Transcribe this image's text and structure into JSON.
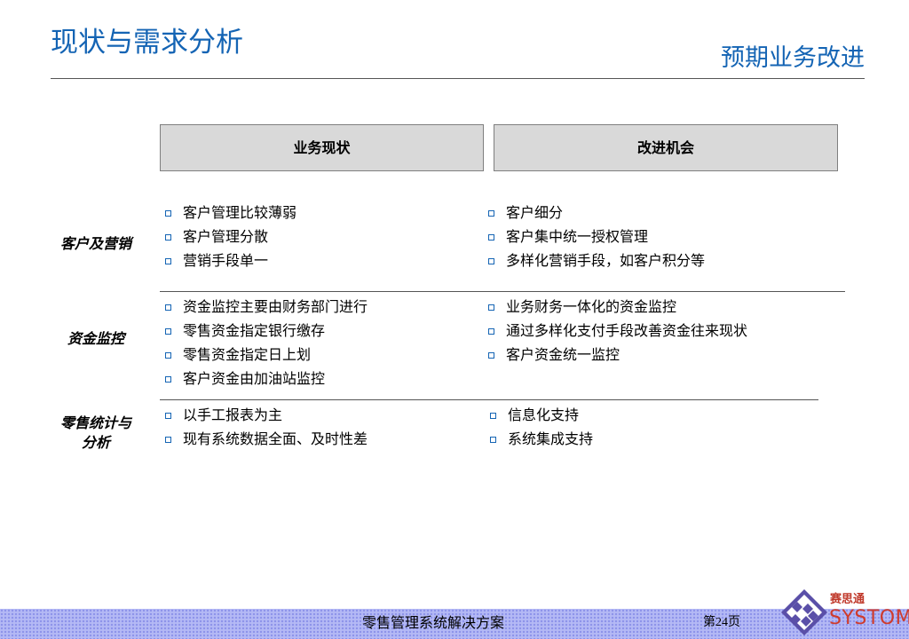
{
  "header": {
    "title": "现状与需求分析",
    "subtitle": "预期业务改进"
  },
  "columns": {
    "current": "业务现状",
    "improve": "改进机会"
  },
  "rows": [
    {
      "label": "客户及营销",
      "current": [
        "客户管理比较薄弱",
        "客户管理分散",
        "营销手段单一"
      ],
      "improve": [
        "客户细分",
        "客户集中统一授权管理",
        "多样化营销手段，如客户积分等"
      ]
    },
    {
      "label": "资金监控",
      "current": [
        "资金监控主要由财务部门进行",
        "零售资金指定银行缴存",
        "零售资金指定日上划",
        "客户资金由加油站监控"
      ],
      "improve": [
        "业务财务一体化的资金监控",
        "通过多样化支付手段改善资金往来现状",
        "客户资金统一监控"
      ]
    },
    {
      "label_lines": [
        "零售统计与",
        "分析"
      ],
      "current": [
        "以手工报表为主",
        "现有系统数据全面、及时性差"
      ],
      "improve": [
        "信息化支持",
        "系统集成支持"
      ]
    }
  ],
  "footer": {
    "title": "零售管理系统解决方案",
    "page": "第24页"
  },
  "logo": {
    "cn": "赛思通",
    "en": "SYSTOM"
  },
  "colors": {
    "title": "#1464b4",
    "bullet": "#1464b4",
    "header_fill": "#d9d9d9",
    "footer": "#b4b9f5",
    "logo": "#cf3b2c"
  }
}
